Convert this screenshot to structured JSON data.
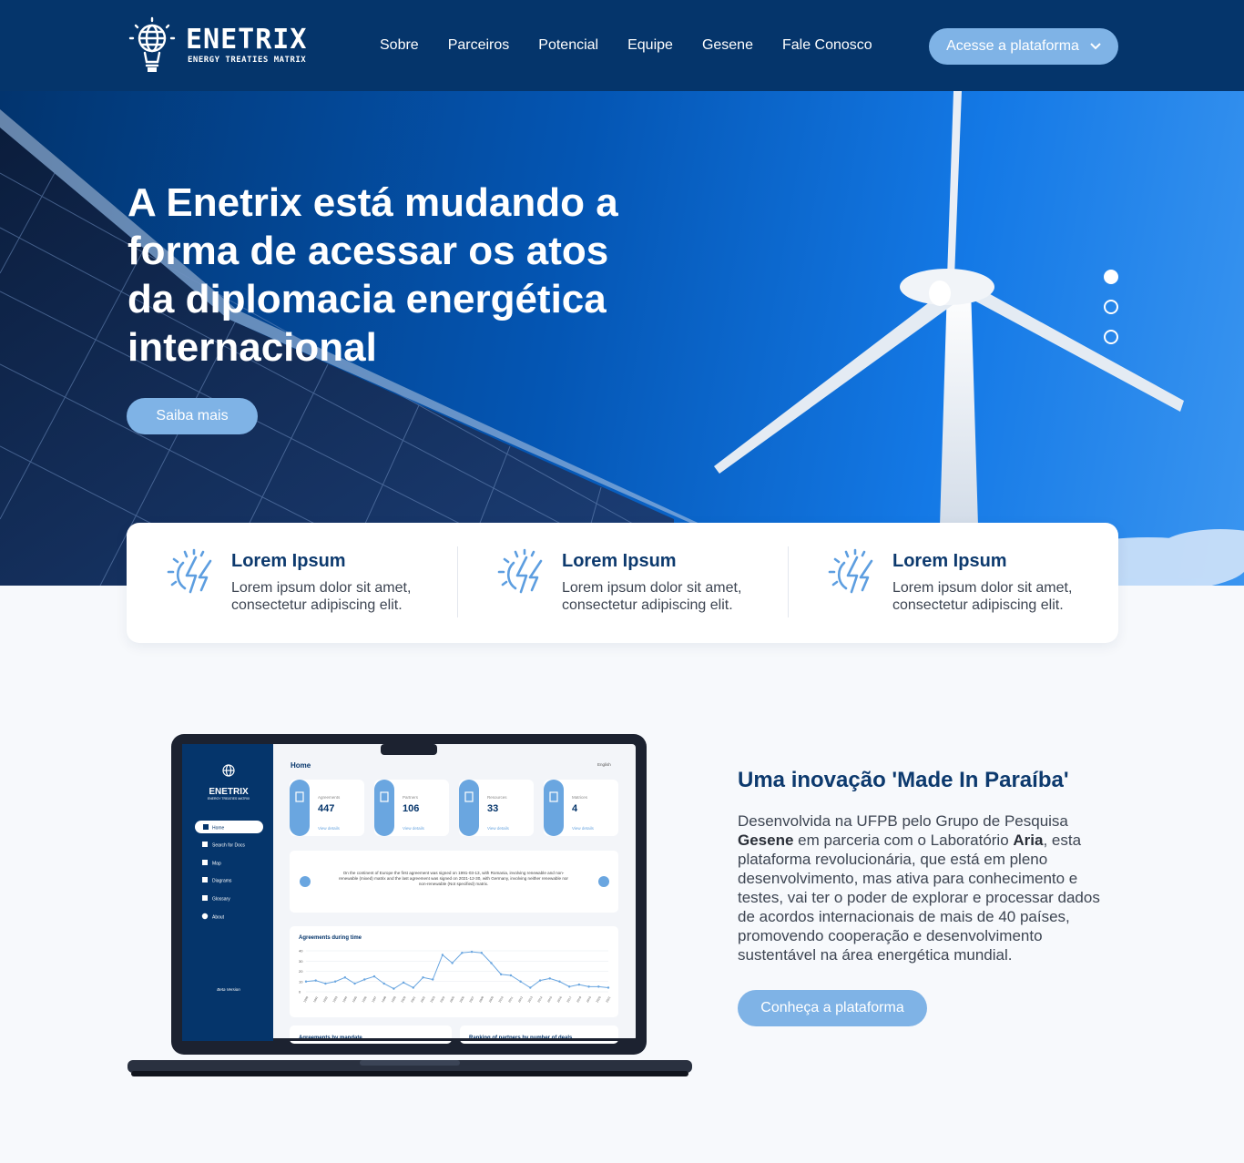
{
  "header": {
    "logo_word": "ENETRIX",
    "logo_sub": "ENERGY TREATIES MATRIX",
    "nav": [
      "Sobre",
      "Parceiros",
      "Potencial",
      "Equipe",
      "Gesene",
      "Fale Conosco"
    ],
    "cta_label": "Acesse a plataforma",
    "cta_icon": "chevron-down-icon"
  },
  "hero": {
    "title": "A Enetrix está mudando a forma de acessar os atos da diplomacia energética internacional",
    "button_label": "Saiba mais",
    "slides": 3,
    "active_slide": 1
  },
  "features": [
    {
      "icon": "energy-bolt-icon",
      "title": "Lorem Ipsum",
      "text": "Lorem ipsum dolor sit amet, consectetur adipiscing elit."
    },
    {
      "icon": "energy-bolt-icon",
      "title": "Lorem Ipsum",
      "text": "Lorem ipsum dolor sit amet, consectetur adipiscing elit."
    },
    {
      "icon": "energy-bolt-icon",
      "title": "Lorem Ipsum",
      "text": "Lorem ipsum dolor sit amet, consectetur adipiscing elit."
    }
  ],
  "laptop_screen": {
    "brand": "ENETRIX",
    "brand_sub": "ENERGY TREATIES MATRIX",
    "menu": [
      "Home",
      "Search for Docs",
      "Map",
      "Diagrams",
      "Glossary",
      "About"
    ],
    "version": "Beta Version",
    "page_title": "Home",
    "language": "English",
    "stats": [
      {
        "label": "Agreements",
        "value": "447",
        "link": "View details"
      },
      {
        "label": "Partners",
        "value": "106",
        "link": "View details"
      },
      {
        "label": "Resources",
        "value": "33",
        "link": "View details"
      },
      {
        "label": "Matrices",
        "value": "4",
        "link": "View details"
      }
    ],
    "carousel_text": "On the continent of Europe the first agreement was signed on 1991-03-13, with Romania, involving renewable and non-renewable (mixed) matrix and the last agreement was signed on 2021-12-30, with Germany, involving neither renewable nor non-renewable (Not specified) matrix.",
    "chart_title": "Agreements during time",
    "chart_yticks": [
      "40",
      "30",
      "20",
      "10",
      "0"
    ],
    "bottom_cards": [
      "Agreements by mandate",
      "Ranking of partners by number of deals"
    ]
  },
  "chart_data": {
    "type": "line",
    "title": "Agreements during time",
    "x": [
      "1990",
      "1991",
      "1992",
      "1993",
      "1994",
      "1995",
      "1996",
      "1997",
      "1998",
      "1999",
      "2000",
      "2001",
      "2002",
      "2003",
      "2004",
      "2005",
      "2006",
      "2007",
      "2008",
      "2009",
      "2010",
      "2011",
      "2012",
      "2013",
      "2014",
      "2015",
      "2016",
      "2017",
      "2018",
      "2019",
      "2020",
      "2021"
    ],
    "values": [
      10,
      11,
      8,
      10,
      14,
      8,
      12,
      15,
      8,
      3,
      9,
      4,
      14,
      12,
      36,
      28,
      38,
      39,
      38,
      28,
      17,
      16,
      10,
      4,
      11,
      13,
      10,
      5,
      7,
      5,
      5,
      4
    ],
    "ylim": [
      0,
      40
    ],
    "color": "#6aa6e0"
  },
  "about": {
    "title": "Uma inovação 'Made In Paraíba'",
    "text_1": "Desenvolvida na UFPB pelo Grupo de Pesquisa ",
    "bold_1": "Gesene",
    "text_2": " em parceria com o Laboratório ",
    "bold_2": "Aria",
    "text_3": ", esta plataforma revolucionária, que está em pleno desenvolvimento, mas ativa para conhecimento e testes, vai ter o poder de explorar e processar dados de acordos internacionais de mais de 40 países, promovendo cooperação e desenvolvimento sustentável na área energética mundial.",
    "button_label": "Conheça a plataforma"
  },
  "colors": {
    "navy": "#05356b",
    "accent": "#7fb3e6",
    "title": "#0d3a6e"
  }
}
